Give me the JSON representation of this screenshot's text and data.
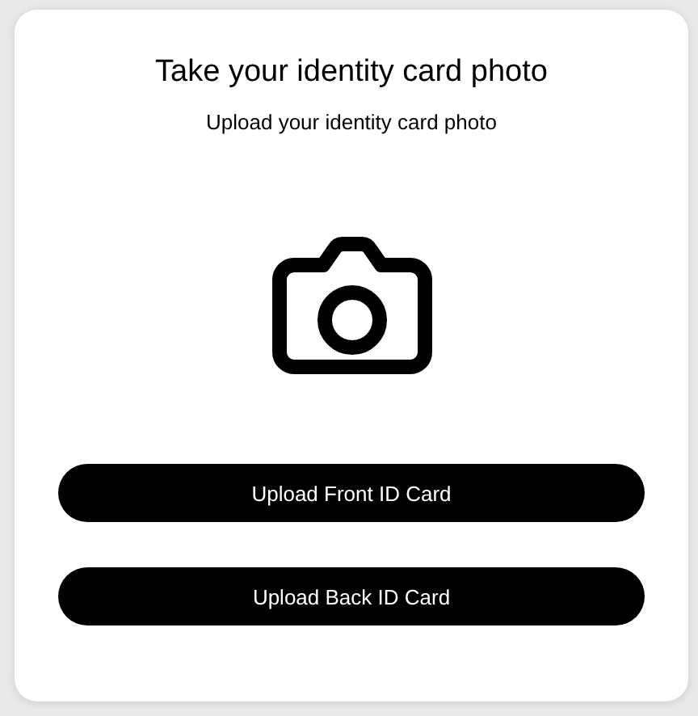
{
  "title": "Take your identity card photo",
  "subtitle": "Upload your identity card photo",
  "buttons": [
    "Upload Front ID Card",
    "Upload Back ID Card"
  ]
}
